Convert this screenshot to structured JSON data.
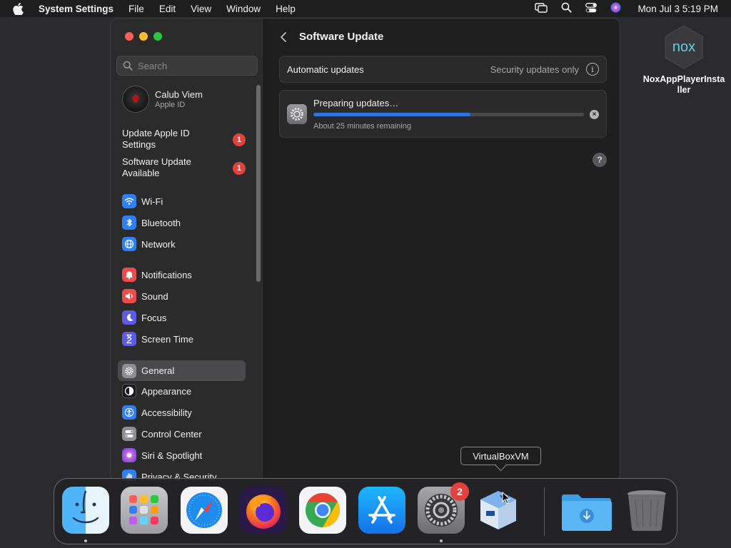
{
  "menubar": {
    "app_name": "System Settings",
    "menus": [
      "File",
      "Edit",
      "View",
      "Window",
      "Help"
    ],
    "clock": "Mon Jul 3  5:19 PM",
    "status_icons": [
      "screen-mirroring-icon",
      "spotlight-search-icon",
      "control-center-icon",
      "siri-icon"
    ]
  },
  "desktop": {
    "icon_label": "NoxAppPlayerInstaller",
    "icon_logo_text": "nox"
  },
  "window": {
    "search": {
      "placeholder": "Search"
    },
    "profile": {
      "name": "Calub Viem",
      "subtitle": "Apple ID"
    },
    "notices": [
      {
        "label": "Update Apple ID Settings",
        "badge": "1"
      },
      {
        "label": "Software Update Available",
        "badge": "1"
      }
    ],
    "sidebar_items": [
      {
        "label": "Wi-Fi",
        "icon": "wifi-icon",
        "color": "#2f7ff6"
      },
      {
        "label": "Bluetooth",
        "icon": "bluetooth-icon",
        "color": "#2f7ff6"
      },
      {
        "label": "Network",
        "icon": "globe-icon",
        "color": "#2f7ff6"
      },
      {
        "label": "Notifications",
        "icon": "bell-icon",
        "color": "#eb4d4b"
      },
      {
        "label": "Sound",
        "icon": "speaker-icon",
        "color": "#eb4d4b"
      },
      {
        "label": "Focus",
        "icon": "moon-icon",
        "color": "#5e5ce6"
      },
      {
        "label": "Screen Time",
        "icon": "hourglass-icon",
        "color": "#5e5ce6"
      },
      {
        "label": "General",
        "icon": "gear-icon",
        "color": "#8e8e93",
        "active": true
      },
      {
        "label": "Appearance",
        "icon": "appearance-icon",
        "color": "#1c1c1e"
      },
      {
        "label": "Accessibility",
        "icon": "accessibility-icon",
        "color": "#2f7ff6"
      },
      {
        "label": "Control Center",
        "icon": "control-center-icon",
        "color": "#8e8e93"
      },
      {
        "label": "Siri & Spotlight",
        "icon": "siri-icon",
        "color": "#9b59d0"
      },
      {
        "label": "Privacy & Security",
        "icon": "hand-icon",
        "color": "#2f7ff6"
      }
    ],
    "main": {
      "title": "Software Update",
      "automatic_updates": {
        "label": "Automatic updates",
        "value": "Security updates only"
      },
      "update": {
        "title": "Preparing updates…",
        "progress": 0.58,
        "remaining": "About 25 minutes remaining"
      },
      "help_label": "?"
    }
  },
  "tooltip": "VirtualBoxVM",
  "dock": {
    "apps": [
      {
        "name": "Finder",
        "icon": "finder-icon",
        "running": true
      },
      {
        "name": "Launchpad",
        "icon": "launchpad-icon",
        "running": false
      },
      {
        "name": "Safari",
        "icon": "safari-icon",
        "running": false
      },
      {
        "name": "Firefox",
        "icon": "firefox-icon",
        "running": false
      },
      {
        "name": "Google Chrome",
        "icon": "chrome-icon",
        "running": false
      },
      {
        "name": "App Store",
        "icon": "app-store-icon",
        "running": false
      },
      {
        "name": "System Settings",
        "icon": "system-settings-icon",
        "running": true,
        "badge": "2"
      },
      {
        "name": "VirtualBoxVM",
        "icon": "virtualbox-icon",
        "running": false
      }
    ],
    "stacks": [
      {
        "name": "Downloads",
        "icon": "downloads-folder-icon"
      },
      {
        "name": "Trash",
        "icon": "trash-icon"
      }
    ]
  }
}
